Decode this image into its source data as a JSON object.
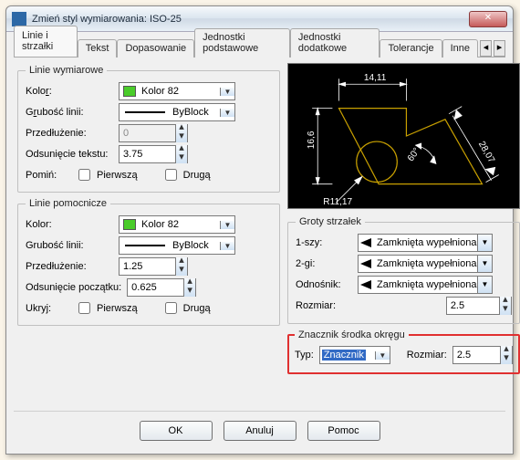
{
  "window": {
    "title": "Zmień styl wymiarowania: ISO-25"
  },
  "tabs": {
    "items": [
      "Linie i strzałki",
      "Tekst",
      "Dopasowanie",
      "Jednostki podstawowe",
      "Jednostki dodatkowe",
      "Tolerancje",
      "Inne"
    ],
    "active": 0
  },
  "dimlines": {
    "legend": "Linie wymiarowe",
    "color_label_pre": "Kolo",
    "color_label_u": "r",
    "color_label_post": ":",
    "color_value": "Kolor 82",
    "thickness_label_pre": "G",
    "thickness_label_u": "r",
    "thickness_label_post": "ubość linii:",
    "thickness_value": "ByBlock",
    "extend_label_full": "Przedłużenie:",
    "extend_value": "0",
    "offset_label_full": "Odsunięcie tekstu:",
    "offset_value": "3.75",
    "skip_label": "Pomiń:",
    "skip1": "Pierwszą",
    "skip2": "Drugą"
  },
  "extlines": {
    "legend": "Linie pomocnicze",
    "color_label": "Kolor:",
    "color_value": "Kolor 82",
    "thickness_label": "Grubość linii:",
    "thickness_value": "ByBlock",
    "extend_label": "Przedłużenie:",
    "extend_value": "1.25",
    "offset_label": "Odsunięcie początku:",
    "offset_value": "0.625",
    "hide_label": "Ukryj:",
    "hide1": "Pierwszą",
    "hide2": "Drugą"
  },
  "arrows": {
    "legend": "Groty strzałek",
    "first_label": "1-szy:",
    "first_value": "Zamknięta wypełniona",
    "second_label": "2-gi:",
    "second_value": "Zamknięta wypełniona",
    "leader_label": "Odnośnik:",
    "leader_value": "Zamknięta wypełniona",
    "size_label": "Rozmiar:",
    "size_value": "2.5"
  },
  "center": {
    "legend": "Znacznik środka okręgu",
    "type_label": "Typ:",
    "type_value": "Znacznik",
    "size_label": "Rozmiar:",
    "size_value": "2.5"
  },
  "preview": {
    "dim_top": "14,11",
    "dim_left": "16,6",
    "dim_radius": "R11,17",
    "dim_angle": "60°",
    "dim_diag": "28,07"
  },
  "buttons": {
    "ok": "OK",
    "cancel": "Anuluj",
    "help": "Pomoc"
  }
}
